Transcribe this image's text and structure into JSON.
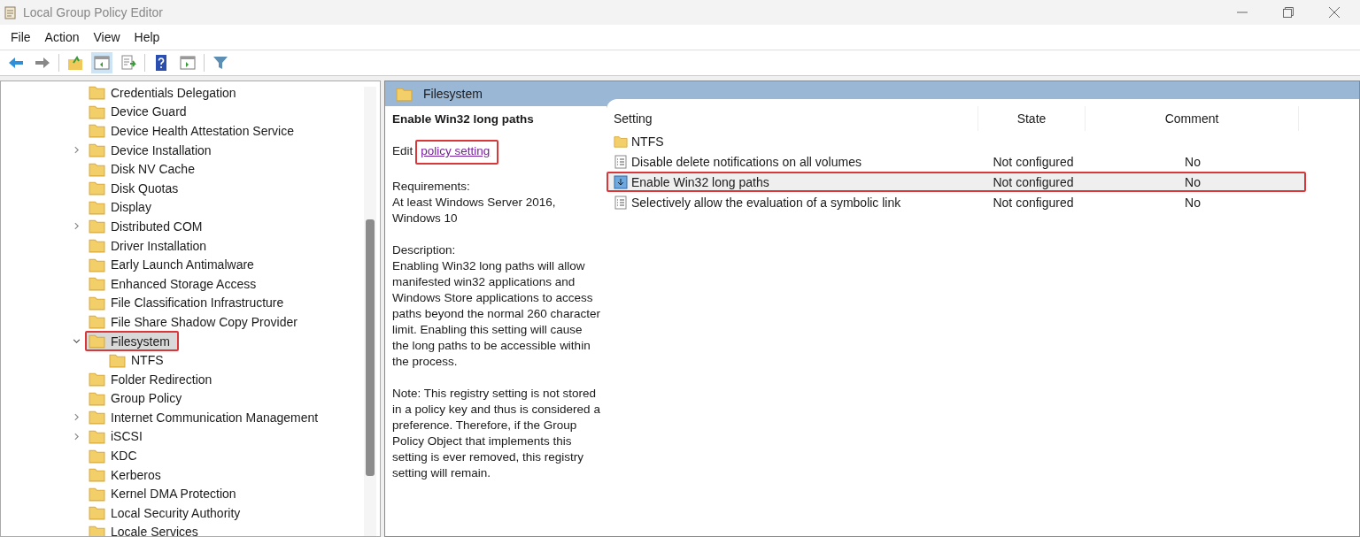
{
  "window": {
    "title": "Local Group Policy Editor"
  },
  "menu": [
    "File",
    "Action",
    "View",
    "Help"
  ],
  "tree": [
    {
      "label": "Credentials Delegation",
      "has_children": false,
      "selected": false,
      "highlighted": false
    },
    {
      "label": "Device Guard",
      "has_children": false,
      "selected": false,
      "highlighted": false
    },
    {
      "label": "Device Health Attestation Service",
      "has_children": false,
      "selected": false,
      "highlighted": false
    },
    {
      "label": "Device Installation",
      "has_children": true,
      "expanded": false,
      "selected": false,
      "highlighted": false
    },
    {
      "label": "Disk NV Cache",
      "has_children": false,
      "selected": false,
      "highlighted": false
    },
    {
      "label": "Disk Quotas",
      "has_children": false,
      "selected": false,
      "highlighted": false
    },
    {
      "label": "Display",
      "has_children": false,
      "selected": false,
      "highlighted": false
    },
    {
      "label": "Distributed COM",
      "has_children": true,
      "expanded": false,
      "selected": false,
      "highlighted": false
    },
    {
      "label": "Driver Installation",
      "has_children": false,
      "selected": false,
      "highlighted": false
    },
    {
      "label": "Early Launch Antimalware",
      "has_children": false,
      "selected": false,
      "highlighted": false
    },
    {
      "label": "Enhanced Storage Access",
      "has_children": false,
      "selected": false,
      "highlighted": false
    },
    {
      "label": "File Classification Infrastructure",
      "has_children": false,
      "selected": false,
      "highlighted": false
    },
    {
      "label": "File Share Shadow Copy Provider",
      "has_children": false,
      "selected": false,
      "highlighted": false
    },
    {
      "label": "Filesystem",
      "has_children": true,
      "expanded": true,
      "selected": true,
      "highlighted": true,
      "children": [
        {
          "label": "NTFS",
          "selected": false,
          "highlighted": false
        }
      ]
    },
    {
      "label": "Folder Redirection",
      "has_children": false,
      "selected": false,
      "highlighted": false
    },
    {
      "label": "Group Policy",
      "has_children": false,
      "selected": false,
      "highlighted": false
    },
    {
      "label": "Internet Communication Management",
      "has_children": true,
      "expanded": false,
      "selected": false,
      "highlighted": false
    },
    {
      "label": "iSCSI",
      "has_children": true,
      "expanded": false,
      "selected": false,
      "highlighted": false
    },
    {
      "label": "KDC",
      "has_children": false,
      "selected": false,
      "highlighted": false
    },
    {
      "label": "Kerberos",
      "has_children": false,
      "selected": false,
      "highlighted": false
    },
    {
      "label": "Kernel DMA Protection",
      "has_children": false,
      "selected": false,
      "highlighted": false
    },
    {
      "label": "Local Security Authority",
      "has_children": false,
      "selected": false,
      "highlighted": false
    },
    {
      "label": "Locale Services",
      "has_children": false,
      "selected": false,
      "highlighted": false
    }
  ],
  "details": {
    "header": "Filesystem",
    "title": "Enable Win32 long paths",
    "edit_prefix": "Edit",
    "edit_link": "policy setting",
    "link_highlighted": true,
    "requirements_label": "Requirements:",
    "requirements": "At least Windows Server 2016, Windows 10",
    "description_label": "Description:",
    "description": "Enabling Win32 long paths will allow manifested win32 applications and Windows Store applications to access paths beyond the normal 260 character limit.  Enabling this setting will cause the long paths to be accessible within the process.",
    "note": "Note:  This registry setting is not stored in a policy key and thus is considered a preference.  Therefore, if the Group Policy Object that implements this setting is ever removed, this registry setting will remain."
  },
  "table": {
    "columns": [
      "Setting",
      "State",
      "Comment"
    ],
    "rows": [
      {
        "kind": "folder",
        "setting": "NTFS",
        "selected": false,
        "highlighted": false
      },
      {
        "kind": "policy",
        "setting": "Disable delete notifications on all volumes",
        "state": "Not configured",
        "comment": "No",
        "selected": false,
        "highlighted": false
      },
      {
        "kind": "policy",
        "setting": "Enable Win32 long paths",
        "state": "Not configured",
        "comment": "No",
        "selected": true,
        "highlighted": true
      },
      {
        "kind": "policy",
        "setting": "Selectively allow the evaluation of a symbolic link",
        "state": "Not configured",
        "comment": "No",
        "selected": false,
        "highlighted": false
      }
    ]
  }
}
